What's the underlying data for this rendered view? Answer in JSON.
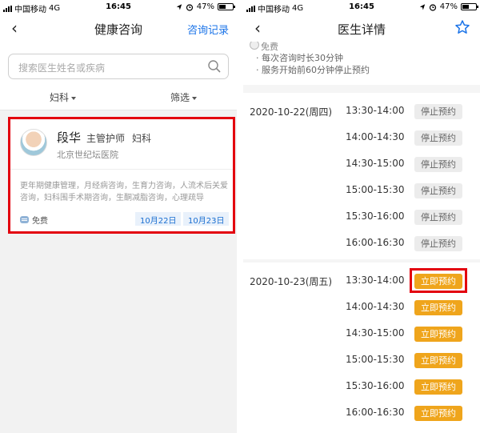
{
  "colors": {
    "accent": "#1a73e8",
    "highlight": "#e3000e",
    "book_button": "#efa51c",
    "stop_button": "#ececec"
  },
  "status_bar": {
    "carrier": "中国移动",
    "network": "4G",
    "time": "16:45",
    "battery": "47%",
    "battery_level": 0.47
  },
  "left_screen": {
    "nav": {
      "title": "健康咨询",
      "right_link": "咨询记录"
    },
    "search": {
      "placeholder": "搜索医生姓名或疾病"
    },
    "filters": {
      "department": "妇科",
      "filter": "筛选"
    },
    "doctor_card": {
      "name": "段华",
      "title": "主管护师",
      "department": "妇科",
      "hospital": "北京世纪坛医院",
      "specialties": "更年期健康管理，月经病咨询，生育力咨询，人流术后关爱咨询，妇科围手术期咨询，生酮减脂咨询，心理疏导",
      "fee": "免费",
      "dates": [
        "10月22日",
        "10月23日"
      ]
    }
  },
  "right_screen": {
    "nav": {
      "title": "医生详情"
    },
    "info": {
      "fee_label": "免费",
      "lines": [
        "· 每次咨询时长30分钟",
        "· 服务开始前60分钟停止预约"
      ]
    },
    "days": [
      {
        "date": "2020-10-22(周四)",
        "slots": [
          {
            "time": "13:30-14:00",
            "action": "停止预约",
            "state": "stopped"
          },
          {
            "time": "14:00-14:30",
            "action": "停止预约",
            "state": "stopped"
          },
          {
            "time": "14:30-15:00",
            "action": "停止预约",
            "state": "stopped"
          },
          {
            "time": "15:00-15:30",
            "action": "停止预约",
            "state": "stopped"
          },
          {
            "time": "15:30-16:00",
            "action": "停止预约",
            "state": "stopped"
          },
          {
            "time": "16:00-16:30",
            "action": "停止预约",
            "state": "stopped"
          }
        ]
      },
      {
        "date": "2020-10-23(周五)",
        "slots": [
          {
            "time": "13:30-14:00",
            "action": "立即预约",
            "state": "available"
          },
          {
            "time": "14:00-14:30",
            "action": "立即预约",
            "state": "available"
          },
          {
            "time": "14:30-15:00",
            "action": "立即预约",
            "state": "available"
          },
          {
            "time": "15:00-15:30",
            "action": "立即预约",
            "state": "available"
          },
          {
            "time": "15:30-16:00",
            "action": "立即预约",
            "state": "available"
          },
          {
            "time": "16:00-16:30",
            "action": "立即预约",
            "state": "available"
          }
        ]
      }
    ]
  }
}
